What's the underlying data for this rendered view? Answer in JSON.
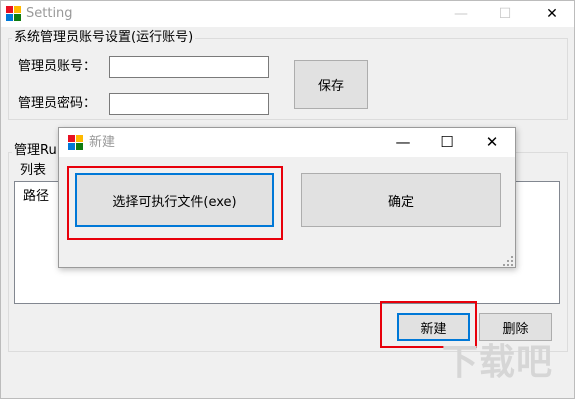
{
  "main_window": {
    "title": "Setting",
    "caption_buttons": {
      "minimize": "—",
      "maximize": "☐",
      "close": "✕"
    }
  },
  "admin_group": {
    "legend": "系统管理员账号设置(运行账号)",
    "account_label": "管理员账号：",
    "account_value": "",
    "password_label": "管理员密码：",
    "password_value": "",
    "save_button": "保存"
  },
  "run_group": {
    "legend": "管理Ru",
    "list_group_legend": "列表",
    "list_items": [
      "路径"
    ],
    "new_button": "新建",
    "delete_button": "删除"
  },
  "dialog": {
    "title": "新建",
    "caption_buttons": {
      "minimize": "—",
      "maximize": "☐",
      "close": "✕"
    },
    "select_exe_button": "选择可执行文件(exe)",
    "ok_button": "确定"
  },
  "highlight_color": "#e8000b",
  "watermark": {
    "text": "下载吧"
  }
}
